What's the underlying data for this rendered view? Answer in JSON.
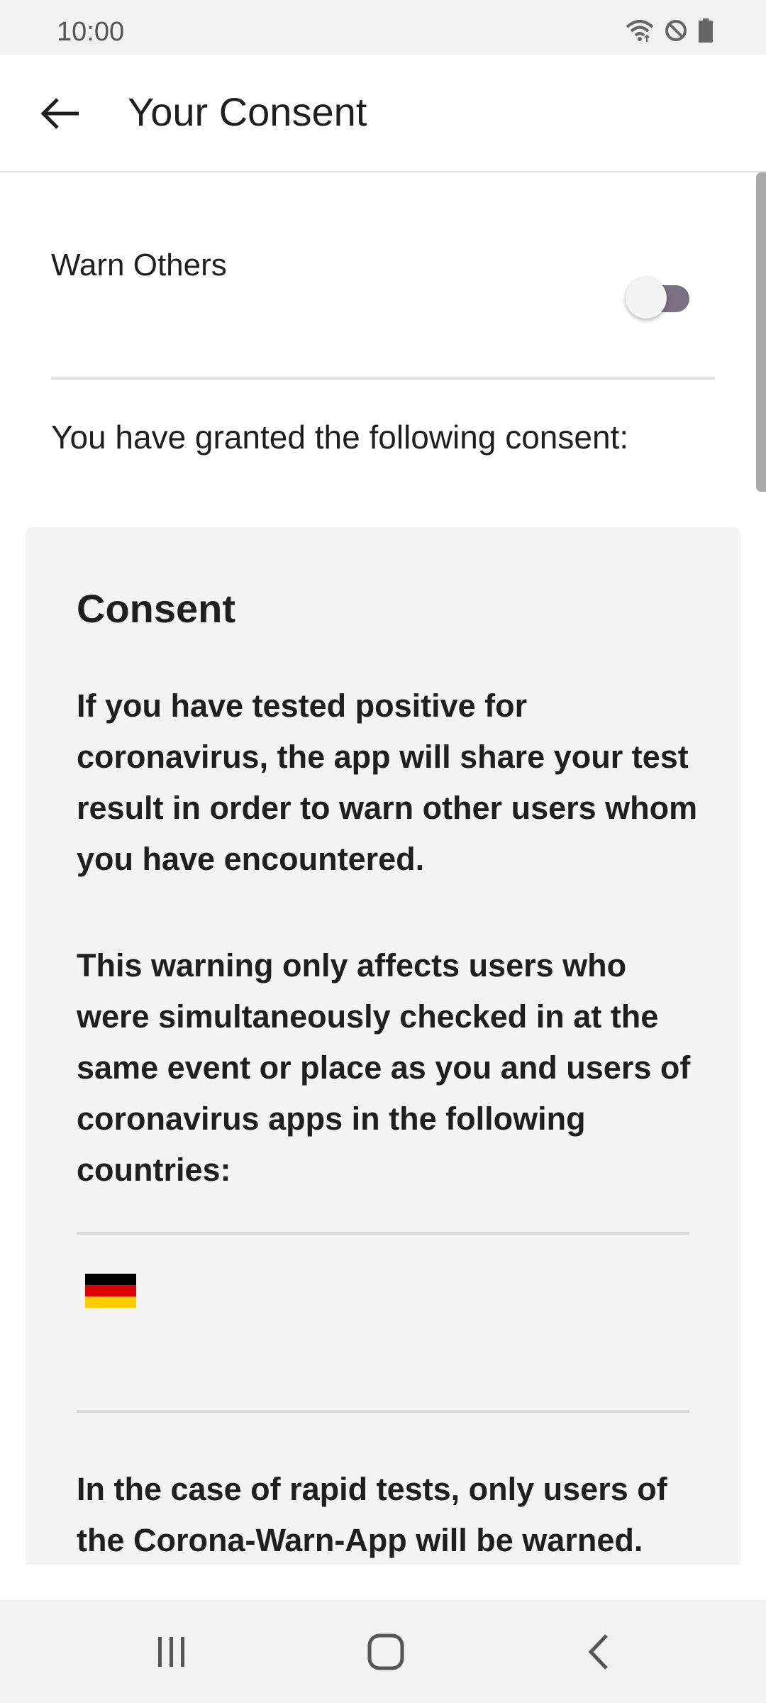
{
  "status_bar": {
    "time": "10:00",
    "icons": [
      "wifi-icon",
      "do-not-disturb-icon",
      "battery-icon"
    ]
  },
  "app_bar": {
    "title": "Your Consent",
    "back_icon": "arrow-back-icon"
  },
  "warn_others": {
    "label": "Warn Others",
    "toggle_on": false
  },
  "granted_text": "You have granted the following consent:",
  "consent": {
    "title": "Consent",
    "paragraph1": "If you have tested positive for coronavirus, the app will share your test result in order to warn other users whom you have encountered.",
    "paragraph2": "This warning only affects users who were simultaneously checked in at the same event or place as you and users of coronavirus apps in the following countries:",
    "countries": [
      {
        "icon": "germany-flag-icon",
        "colors": [
          "#000000",
          "#dd0000",
          "#ffce00"
        ]
      }
    ],
    "paragraph3": "In the case of rapid tests, only users of the Corona-Warn-App will be warned."
  },
  "nav_bar": {
    "buttons": [
      "recent-apps-icon",
      "home-icon",
      "back-icon"
    ]
  },
  "colors": {
    "toggle_track": "#7a7182",
    "card_background": "#f4f4f4",
    "system_bar": "#f1f1f1"
  }
}
